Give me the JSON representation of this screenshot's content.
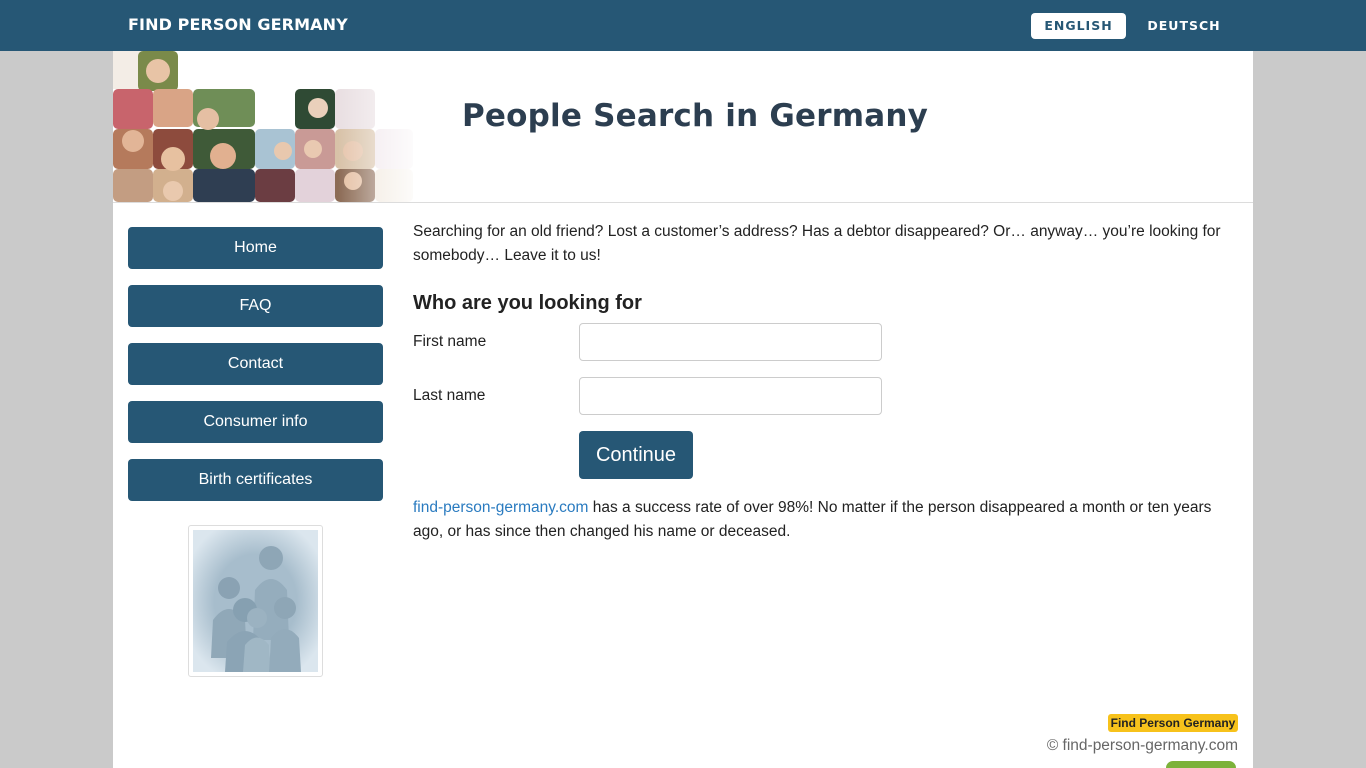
{
  "topbar": {
    "brand": "FIND PERSON GERMANY",
    "lang_english": "ENGLISH",
    "lang_deutsch": "DEUTSCH"
  },
  "header": {
    "title": "People Search in Germany"
  },
  "nav": {
    "items": [
      "Home",
      "FAQ",
      "Contact",
      "Consumer info",
      "Birth certificates"
    ]
  },
  "main": {
    "intro": "Searching for an old friend? Lost a customer’s address? Has a debtor disappeared? Or… anyway… you’re looking for somebody… Leave it to us!",
    "form_heading": "Who are you looking for",
    "first_name_label": "First name",
    "first_name_value": "",
    "last_name_label": "Last name",
    "last_name_value": "",
    "continue_label": "Continue",
    "site_link": "find-person-germany.com",
    "success_text": " has a success rate of over 98%! No matter if the person disappeared a month or ten years ago, or has since then changed his name or deceased."
  },
  "footer": {
    "badge": "Find Person Germany",
    "copyright": "© find-person-germany.com"
  },
  "colors": {
    "brand_blue": "#265775",
    "link_blue": "#2a7bc0",
    "badge_yellow": "#f7c21b"
  }
}
